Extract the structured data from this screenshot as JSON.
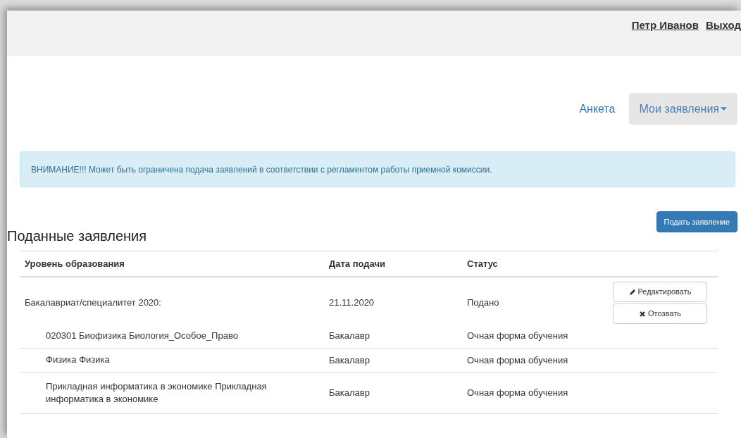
{
  "header": {
    "user": "Петр Иванов",
    "logout": "Выход"
  },
  "nav": [
    {
      "label": "Анкета",
      "selected": false,
      "dropdown": false
    },
    {
      "label": "Мои заявления",
      "selected": true,
      "dropdown": true
    }
  ],
  "alert": "ВНИМАНИЕ!!! Может быть ограничена подача заявлений в соответствии с регламентом работы приемной комиссии.",
  "submit_button": "Подать заявление",
  "heading": "Поданные заявления",
  "table": {
    "columns": [
      "Уровень образования",
      "Дата подачи",
      "Статус"
    ],
    "applications": [
      {
        "level": "Бакалавриат/специалитет 2020:",
        "date": "21.11.2020",
        "status": "Подано",
        "actions": [
          {
            "kind": "edit",
            "label": "Редактировать"
          },
          {
            "kind": "withdraw",
            "label": "Отозвать"
          }
        ],
        "programs": [
          {
            "name": "020301 Биофизика Биология_Особое_Право",
            "degree": "Бакалавр",
            "form": "Очная форма обучения"
          },
          {
            "name": "Физика Физика",
            "degree": "Бакалавр",
            "form": "Очная форма обучения"
          },
          {
            "name": "Прикладная информатика в экономике Прикладная информатика в экономике",
            "degree": "Бакалавр",
            "form": "Очная форма обучения"
          }
        ]
      }
    ]
  }
}
